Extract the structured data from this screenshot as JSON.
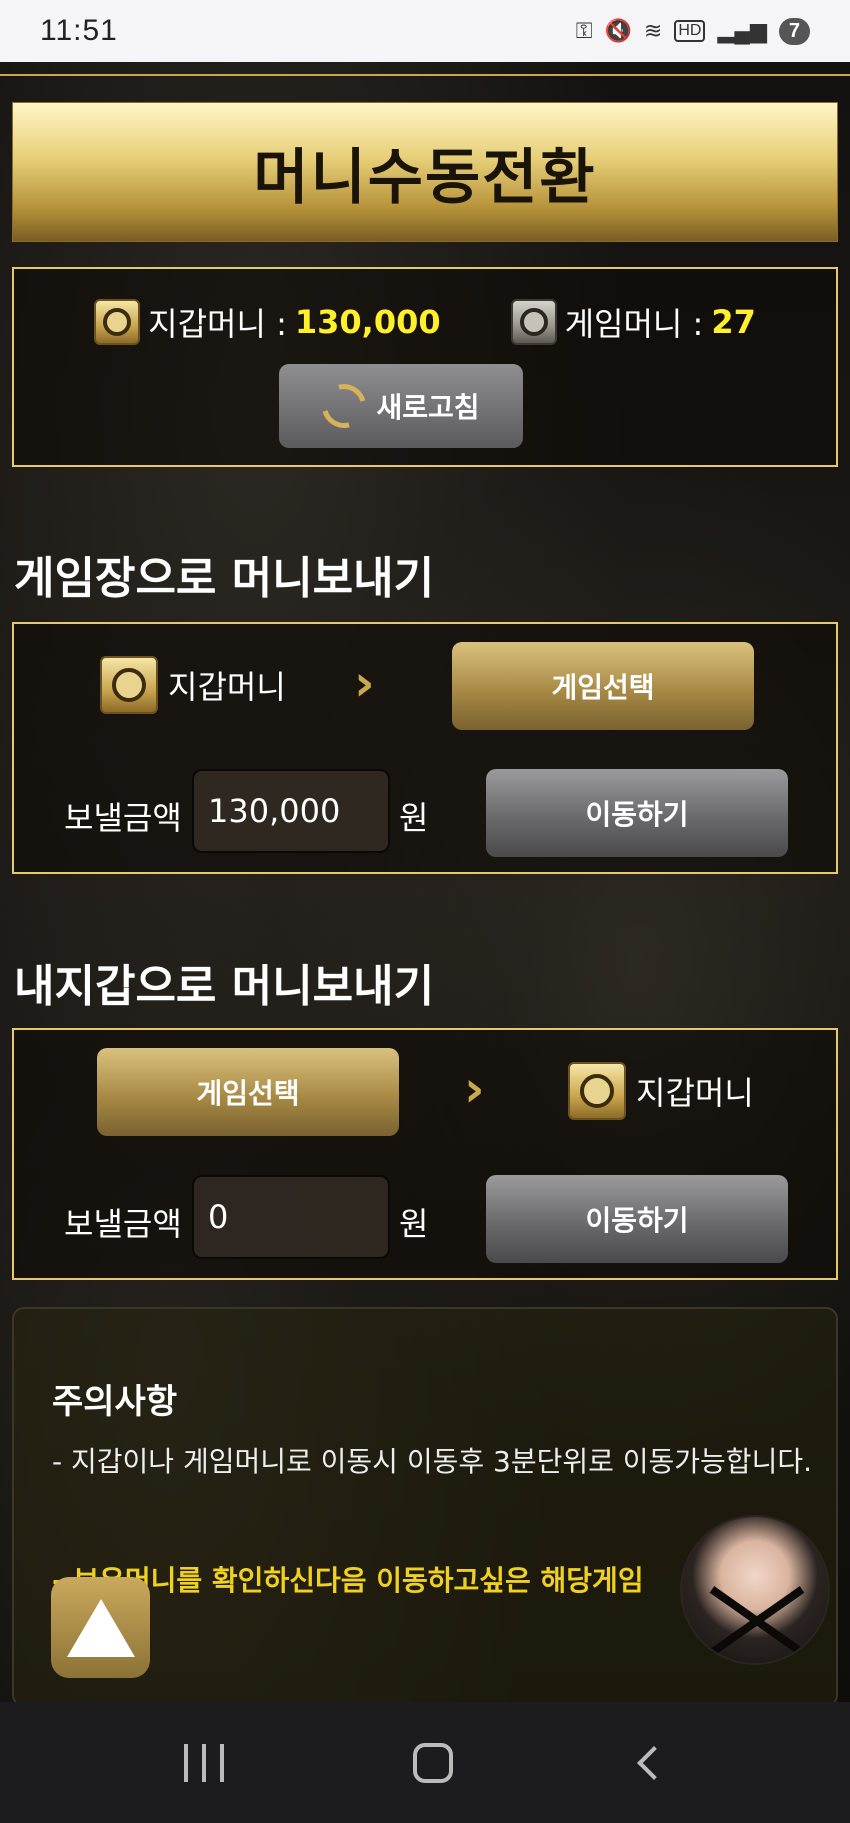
{
  "status_bar": {
    "time": "11:51",
    "battery": "7",
    "icons": [
      "key-icon",
      "mute-icon",
      "wifi-icon",
      "hd-icon",
      "signal-icon",
      "battery-icon"
    ]
  },
  "header": {
    "title": "머니수동전환"
  },
  "balance": {
    "wallet_label": "지갑머니 :",
    "wallet_value": "130,000",
    "game_label": "게임머니 :",
    "game_value": "27",
    "refresh_label": "새로고침"
  },
  "to_game": {
    "title": "게임장으로 머니보내기",
    "source_label": "지갑머니",
    "select_label": "게임선택",
    "amount_label": "보낼금액",
    "amount_value": "130,000",
    "unit": "원",
    "move_label": "이동하기"
  },
  "to_wallet": {
    "title": "내지갑으로 머니보내기",
    "select_label": "게임선택",
    "target_label": "지갑머니",
    "amount_label": "보낼금액",
    "amount_value": "0",
    "unit": "원",
    "move_label": "이동하기"
  },
  "notice": {
    "title": "주의사항",
    "line1": "- 지갑이나 게임머니로 이동시 이동후 3분단위로 이동가능합니다.",
    "line2": "- 보유머니를 확인하신다음 이동하고싶은 해당게임"
  },
  "colors": {
    "accent_gold": "#e6c86e",
    "value_yellow": "#fff02a",
    "notice_yellow": "#f0d020"
  }
}
